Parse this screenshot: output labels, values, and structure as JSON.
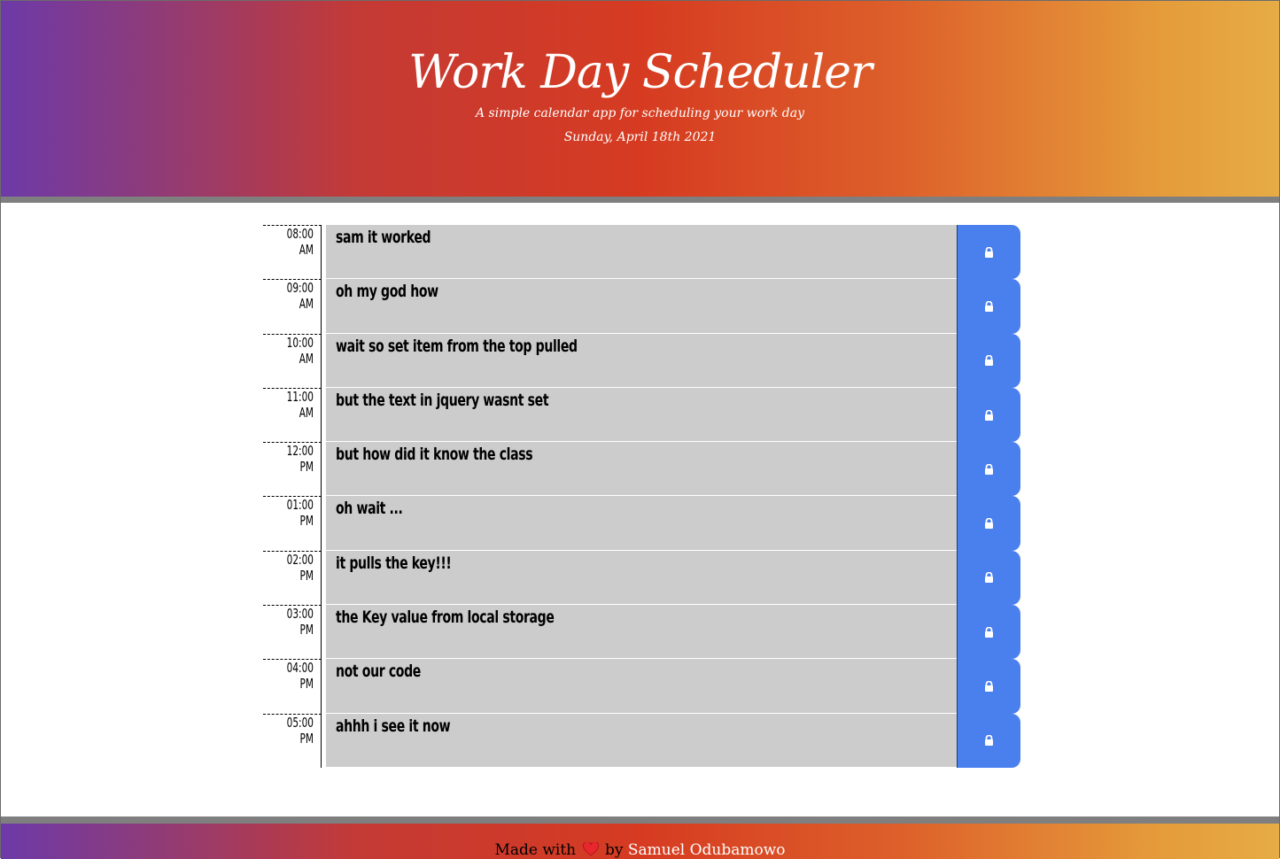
{
  "header": {
    "title": "Work Day Scheduler",
    "subtitle": "A simple calendar app for scheduling your work day",
    "current_day": "Sunday, April 18th 2021"
  },
  "schedule": [
    {
      "hour": "08:00 AM",
      "description": "sam it worked"
    },
    {
      "hour": "09:00 AM",
      "description": "oh my god how"
    },
    {
      "hour": "10:00 AM",
      "description": "wait so set item from the top pulled"
    },
    {
      "hour": "11:00 AM",
      "description": "but the text in jquery wasnt set"
    },
    {
      "hour": "12:00 PM",
      "description": "but how did it know the class"
    },
    {
      "hour": "01:00 PM",
      "description": "oh wait ..."
    },
    {
      "hour": "02:00 PM",
      "description": "it pulls the key!!!"
    },
    {
      "hour": "03:00 PM",
      "description": "the Key value from local storage"
    },
    {
      "hour": "04:00 PM",
      "description": "not our code"
    },
    {
      "hour": "05:00 PM",
      "description": "ahhh i see it now"
    }
  ],
  "save_icon": "lock-icon",
  "footer": {
    "made_with": "Made with",
    "by": "by",
    "author": "Samuel Odubamowo",
    "heart_icon": "heart-icon"
  },
  "colors": {
    "save_button": "#4a7fee",
    "past_row": "#cccccc",
    "divider": "#7f7f7f"
  }
}
